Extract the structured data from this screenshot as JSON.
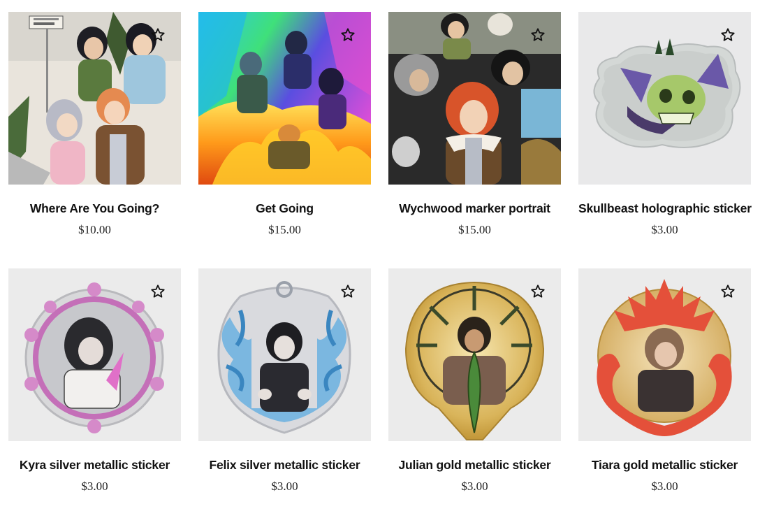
{
  "products": [
    {
      "title": "Where Are You Going?",
      "price": "$10.00",
      "image": "illustration-group-street-sign",
      "favorite_icon": "star-outline-icon"
    },
    {
      "title": "Get Going",
      "price": "$15.00",
      "image": "illustration-rainbow-fire-action",
      "favorite_icon": "star-outline-icon"
    },
    {
      "title": "Wychwood marker portrait",
      "price": "$15.00",
      "image": "illustration-group-portrait-redhead",
      "favorite_icon": "star-outline-icon"
    },
    {
      "title": "Skullbeast holographic sticker",
      "price": "$3.00",
      "image": "holographic-skull-beast-sticker",
      "favorite_icon": "star-outline-icon"
    },
    {
      "title": "Kyra silver metallic sticker",
      "price": "$3.00",
      "image": "silver-pink-frame-sticker",
      "favorite_icon": "star-outline-icon"
    },
    {
      "title": "Felix silver metallic sticker",
      "price": "$3.00",
      "image": "silver-blue-tentacle-sticker",
      "favorite_icon": "star-outline-icon"
    },
    {
      "title": "Julian gold metallic sticker",
      "price": "$3.00",
      "image": "gold-sunburst-leaf-sticker",
      "favorite_icon": "star-outline-icon"
    },
    {
      "title": "Tiara gold metallic sticker",
      "price": "$3.00",
      "image": "gold-red-flame-sticker",
      "favorite_icon": "star-outline-icon"
    }
  ]
}
